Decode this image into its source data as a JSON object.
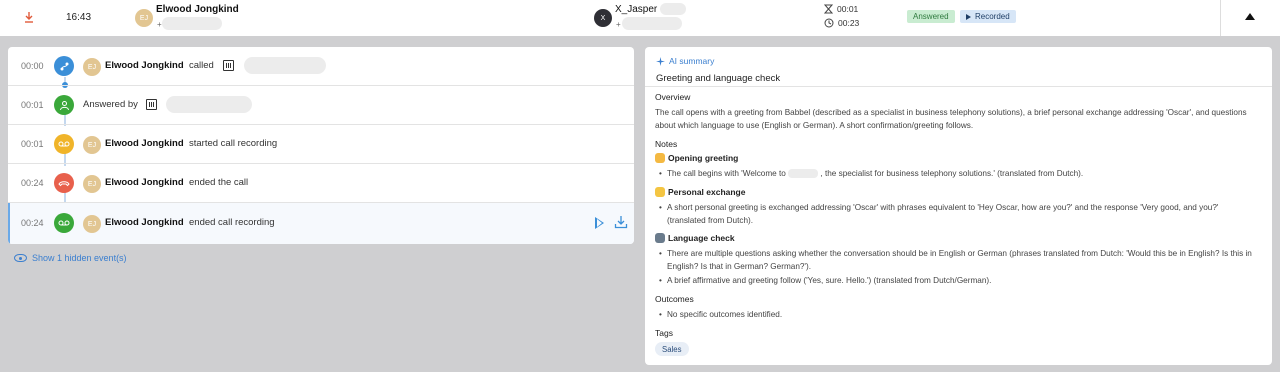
{
  "call": {
    "time": "16:43",
    "caller": {
      "initials": "EJ",
      "name": "Elwood Jongkind",
      "sub": "+"
    },
    "callee": {
      "initials": "X",
      "name": "X_Jasper",
      "sub": "+"
    },
    "durations": {
      "ring": "00:01",
      "talk": "00:23"
    },
    "badges": {
      "answered": "Answered",
      "recorded": "Recorded"
    }
  },
  "events": [
    {
      "time": "00:00",
      "icon": "route-icon",
      "color": "#3b8fd8",
      "avatar": "EJ",
      "name": "Elwood Jongkind",
      "text": "called"
    },
    {
      "time": "00:01",
      "icon": "person-icon",
      "color": "#3aa83a",
      "avatar": "",
      "name": "",
      "text": "Answered by"
    },
    {
      "time": "00:01",
      "icon": "voicemail-icon",
      "color": "#f0b429",
      "avatar": "EJ",
      "name": "Elwood Jongkind",
      "text": "started call recording"
    },
    {
      "time": "00:24",
      "icon": "hangup-icon",
      "color": "#e8604c",
      "avatar": "EJ",
      "name": "Elwood Jongkind",
      "text": "ended the call"
    },
    {
      "time": "00:24",
      "icon": "voicemail-icon",
      "color": "#3aa83a",
      "avatar": "EJ",
      "name": "Elwood Jongkind",
      "text": "ended call recording"
    }
  ],
  "hidden_events": "Show 1 hidden event(s)",
  "summary": {
    "label": "AI summary",
    "title": "Greeting and language check",
    "overview_h": "Overview",
    "overview": "The call opens with a greeting from Babbel (described as a specialist in business telephony solutions), a brief personal exchange addressing 'Oscar', and questions about which language to use (English or German). A short confirmation/greeting follows.",
    "notes_h": "Notes",
    "sections": [
      {
        "title": "Opening greeting",
        "emoji_color": "#f4b942",
        "bullets": [
          "The call begins with 'Welcome to",
          ", the specialist for business telephony solutions.' (translated from Dutch)."
        ]
      },
      {
        "title": "Personal exchange",
        "emoji_color": "#f4c542",
        "bullets": [
          "A short personal greeting is exchanged addressing 'Oscar' with phrases equivalent to 'Hey Oscar, how are you?' and the response 'Very good, and you?' (translated from Dutch)."
        ]
      },
      {
        "title": "Language check",
        "emoji_color": "#6a7b8c",
        "bullets": [
          "There are multiple questions asking whether the conversation should be in English or German (phrases translated from Dutch: 'Would this be in English? Is this in English? Is that in German? German?').",
          "A brief affirmative and greeting follow ('Yes, sure. Hello.') (translated from Dutch/German)."
        ]
      }
    ],
    "outcomes_h": "Outcomes",
    "outcomes": "No specific outcomes identified.",
    "tags_h": "Tags",
    "tag": "Sales"
  }
}
